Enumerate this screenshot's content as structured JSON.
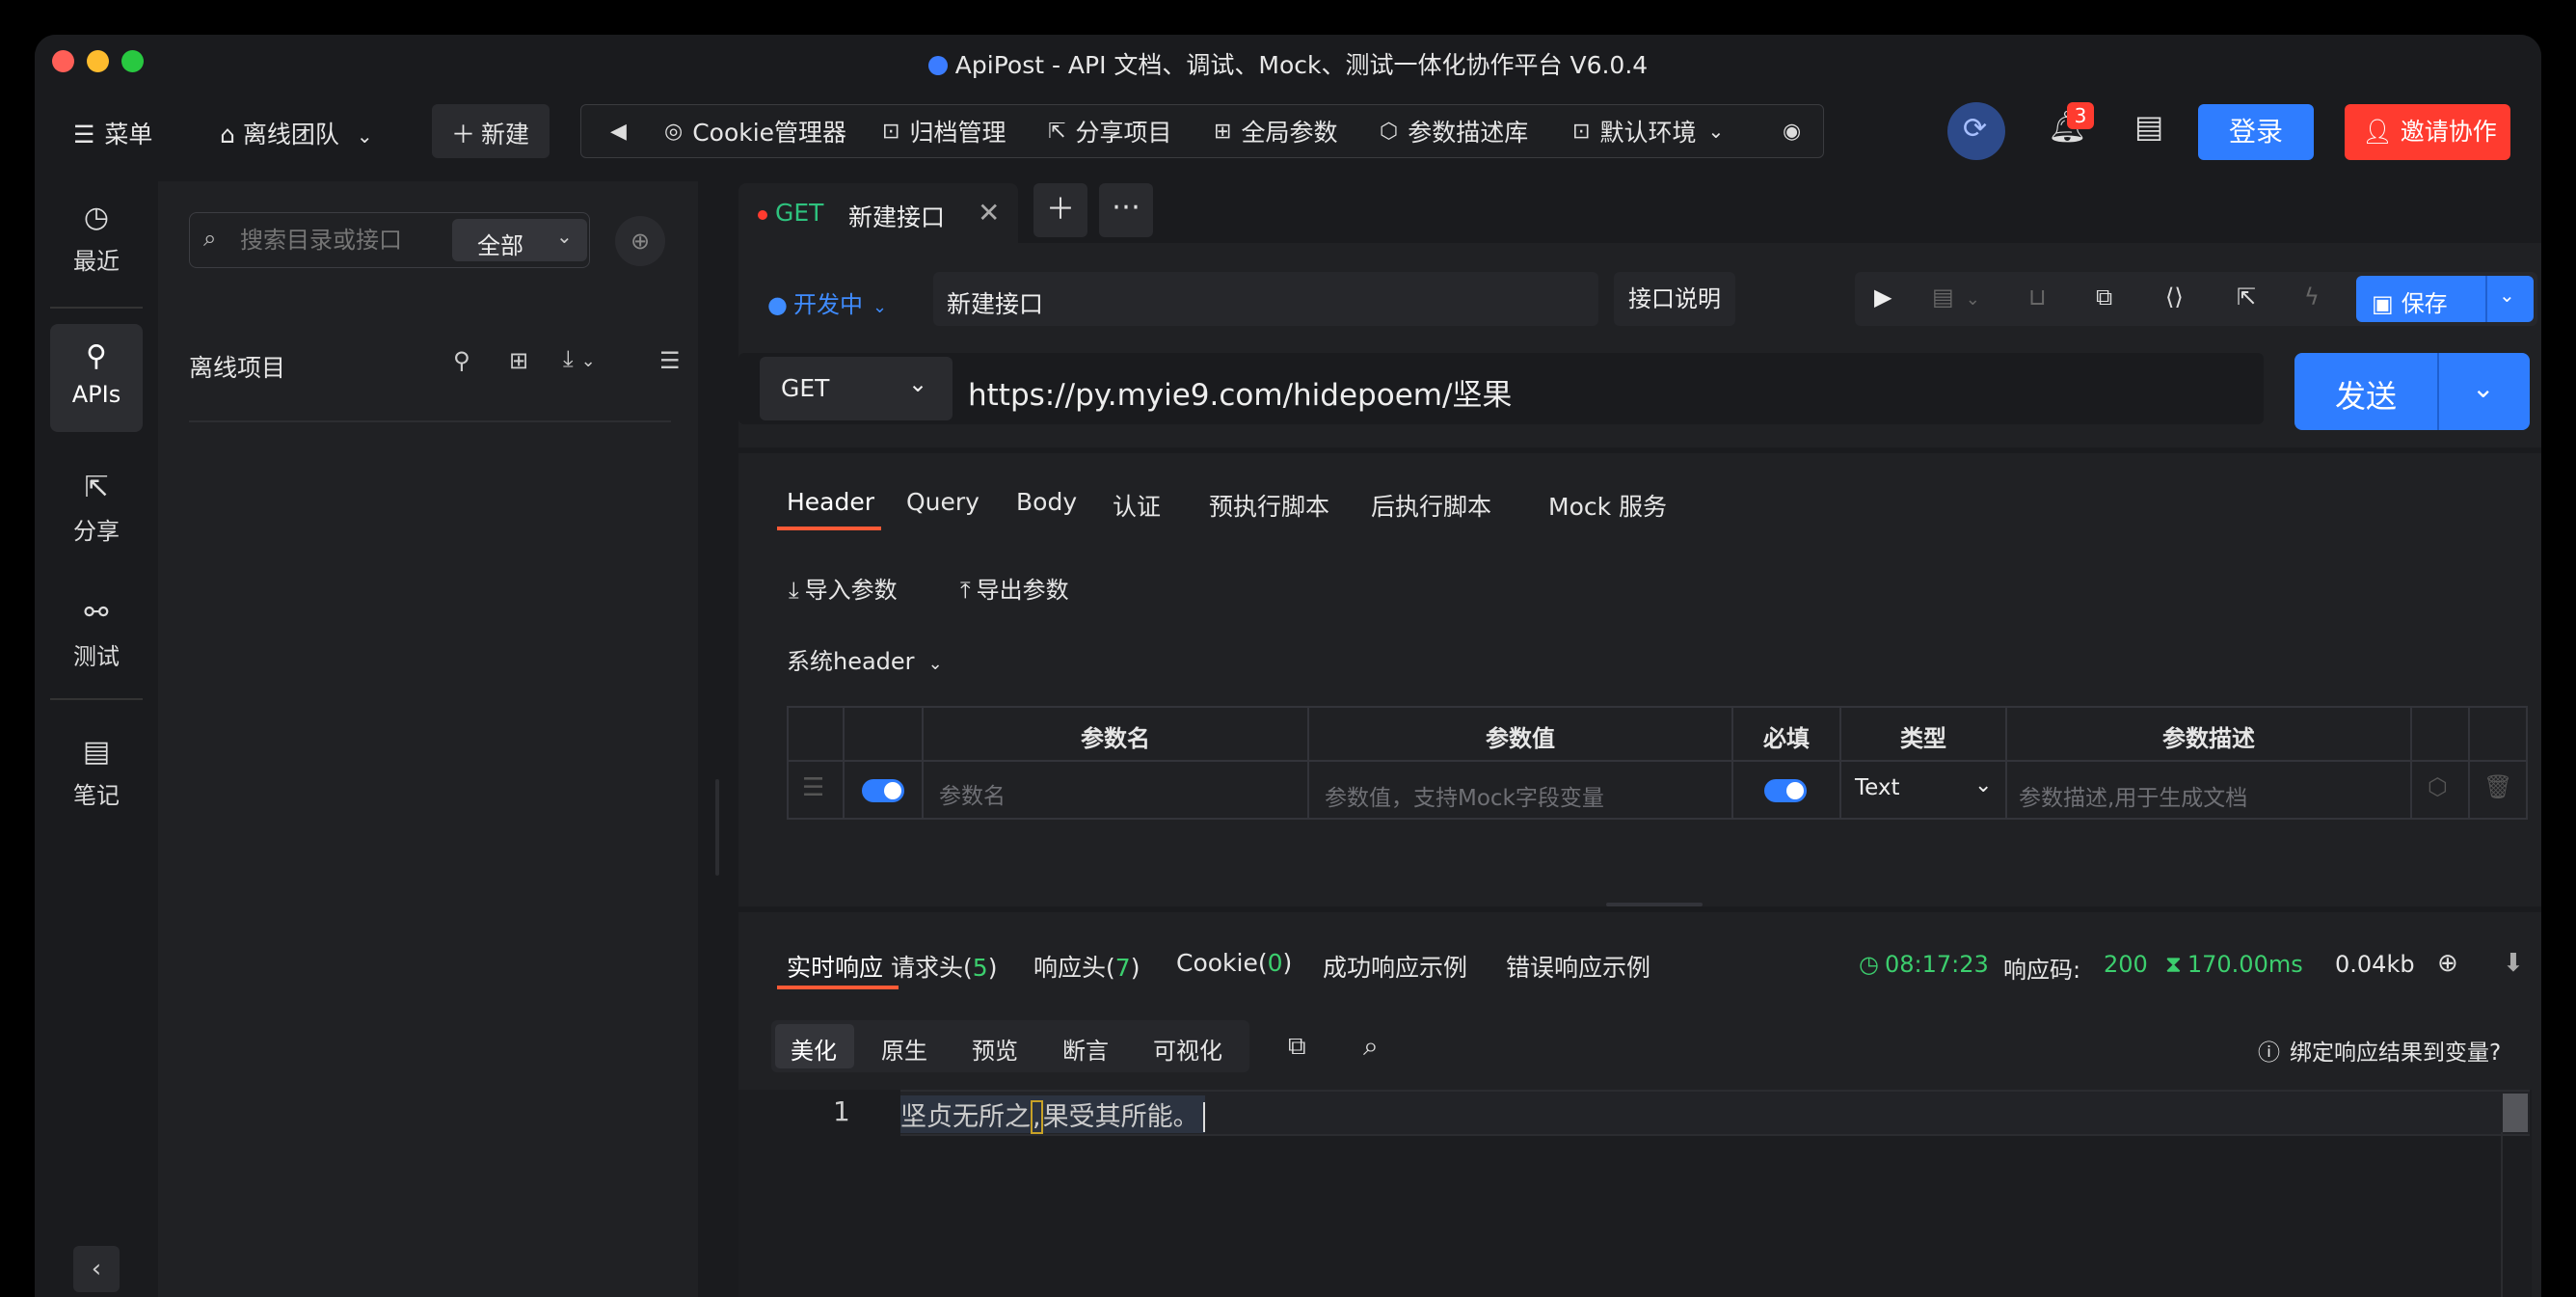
{
  "window": {
    "title": "ApiPost - API 文档、调试、Mock、测试一体化协作平台 V6.0.4"
  },
  "topbar": {
    "menu": "菜单",
    "team": "离线团队",
    "new": "新建",
    "tools": [
      "Cookie管理器",
      "归档管理",
      "分享项目",
      "全局参数",
      "参数描述库",
      "默认环境"
    ],
    "notification_count": "3",
    "login": "登录",
    "invite": "邀请协作"
  },
  "sidebar": {
    "items": [
      {
        "label": "最近",
        "icon": "clock-icon"
      },
      {
        "label": "APIs",
        "icon": "api-icon"
      },
      {
        "label": "分享",
        "icon": "share-icon"
      },
      {
        "label": "测试",
        "icon": "test-icon"
      },
      {
        "label": "笔记",
        "icon": "note-icon"
      }
    ]
  },
  "explorer": {
    "search_placeholder": "搜索目录或接口",
    "filter": "全部",
    "project": "离线项目"
  },
  "tab": {
    "method": "GET",
    "name": "新建接口"
  },
  "request": {
    "status": "开发中",
    "name": "新建接口",
    "doc_button": "接口说明",
    "save": "保存",
    "method": "GET",
    "url": "https://py.myie9.com/hidepoem/坚果",
    "send": "发送"
  },
  "req_tabs": [
    "Header",
    "Query",
    "Body",
    "认证",
    "预执行脚本",
    "后执行脚本",
    "Mock 服务"
  ],
  "params": {
    "import": "导入参数",
    "export": "导出参数",
    "system_header": "系统header",
    "columns": [
      "参数名",
      "参数值",
      "必填",
      "类型",
      "参数描述"
    ],
    "row": {
      "name_placeholder": "参数名",
      "value_placeholder": "参数值，支持Mock字段变量",
      "type": "Text",
      "desc_placeholder": "参数描述,用于生成文档"
    }
  },
  "response": {
    "tabs": {
      "realtime": "实时响应",
      "req_headers": "请求头",
      "req_headers_count": "5",
      "resp_headers": "响应头",
      "resp_headers_count": "7",
      "cookie": "Cookie",
      "cookie_count": "0",
      "success_example": "成功响应示例",
      "error_example": "错误响应示例"
    },
    "time": "08:17:23",
    "code_label": "响应码:",
    "code": "200",
    "duration": "170.00ms",
    "size": "0.04kb",
    "views": [
      "美化",
      "原生",
      "预览",
      "断言",
      "可视化"
    ],
    "bind_text": "绑定响应结果到变量?",
    "line_number": "1",
    "body_part1": "坚贞无所之",
    "body_comma": ",",
    "body_part2": "果受其所能。"
  },
  "colors": {
    "accent": "#2f7dff",
    "invite": "#ff3b2f",
    "active_tab": "#ff5a36",
    "success": "#3ccf6e"
  }
}
